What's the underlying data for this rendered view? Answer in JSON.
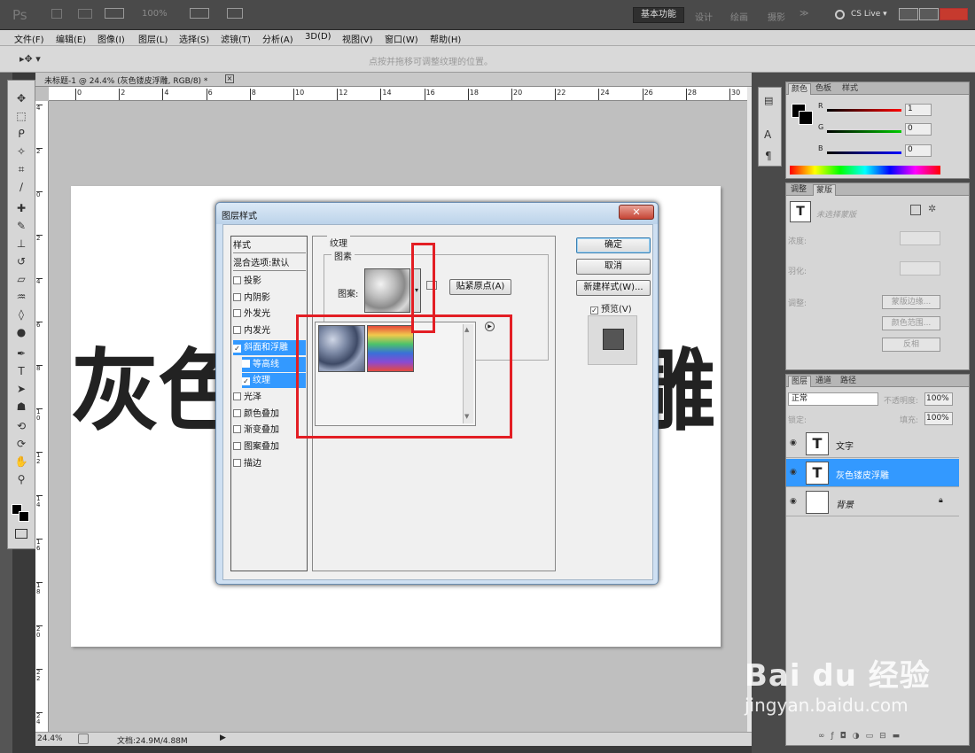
{
  "appbar": {
    "logo": "Ps",
    "zoom": "100%",
    "workspace_active": "基本功能",
    "workspaces": [
      "设计",
      "绘画",
      "摄影"
    ],
    "more": "≫",
    "cslive": "CS Live ▾"
  },
  "menu": [
    "文件(F)",
    "编辑(E)",
    "图像(I)",
    "图层(L)",
    "选择(S)",
    "滤镜(T)",
    "分析(A)",
    "3D(D)",
    "视图(V)",
    "窗口(W)",
    "帮助(H)"
  ],
  "options": {
    "hint": "点按并拖移可调整纹理的位置。"
  },
  "document": {
    "tab_title": "未标题-1 @ 24.4% (灰色镂皮浮雕, RGB/8) *",
    "ruler_h": [
      "0",
      "2",
      "4",
      "6",
      "8",
      "10",
      "12",
      "14",
      "16",
      "18",
      "20",
      "22",
      "24",
      "26",
      "28",
      "30"
    ],
    "ruler_v": [
      "4",
      "2",
      "0",
      "2",
      "4",
      "6",
      "8",
      "1 0",
      "1 2",
      "1 4",
      "1 6",
      "1 8",
      "2 0",
      "2 2",
      "2 4"
    ],
    "canvas_text_left": "灰色",
    "canvas_text_right": "雕"
  },
  "status": {
    "zoom": "24.4%",
    "doc": "文档:24.9M/4.88M"
  },
  "color_panel": {
    "tabs": [
      "颜色",
      "色板",
      "样式"
    ],
    "r_label": "R",
    "g_label": "G",
    "b_label": "B",
    "r": "1",
    "g": "0",
    "b": "0"
  },
  "adjust_panel": {
    "tabs": [
      "调整",
      "蒙版"
    ],
    "no_mask": "未选择蒙版",
    "density": "浓度:",
    "feather": "羽化:",
    "refine": "调整:",
    "btn_edge": "蒙版边缘...",
    "btn_range": "颜色范围...",
    "btn_invert": "反相"
  },
  "layers_panel": {
    "tabs": [
      "图层",
      "通道",
      "路径"
    ],
    "blend_mode": "正常",
    "opacity_label": "不透明度:",
    "opacity": "100%",
    "lock_label": "锁定:",
    "fill_label": "填充:",
    "fill": "100%",
    "layers": [
      {
        "name": "文字",
        "thumb": "T",
        "selected": false
      },
      {
        "name": "灰色镂皮浮雕",
        "thumb": "T",
        "selected": true
      },
      {
        "name": "背景",
        "thumb": "",
        "selected": false
      }
    ]
  },
  "dialog": {
    "title": "图层样式",
    "close": "✕",
    "styles_header": "样式",
    "blend_options": "混合选项:默认",
    "styles": [
      {
        "label": "投影",
        "checked": false,
        "sub": false,
        "selected": false
      },
      {
        "label": "内阴影",
        "checked": false,
        "sub": false,
        "selected": false
      },
      {
        "label": "外发光",
        "checked": false,
        "sub": false,
        "selected": false
      },
      {
        "label": "内发光",
        "checked": false,
        "sub": false,
        "selected": false
      },
      {
        "label": "斜面和浮雕",
        "checked": true,
        "sub": false,
        "selected": true
      },
      {
        "label": "等高线",
        "checked": false,
        "sub": true,
        "selected": true
      },
      {
        "label": "纹理",
        "checked": true,
        "sub": true,
        "selected": true
      },
      {
        "label": "光泽",
        "checked": false,
        "sub": false,
        "selected": false
      },
      {
        "label": "颜色叠加",
        "checked": false,
        "sub": false,
        "selected": false
      },
      {
        "label": "渐变叠加",
        "checked": false,
        "sub": false,
        "selected": false
      },
      {
        "label": "图案叠加",
        "checked": false,
        "sub": false,
        "selected": false
      },
      {
        "label": "描边",
        "checked": false,
        "sub": false,
        "selected": false
      }
    ],
    "group_texture": "纹理",
    "group_pattern": "图素",
    "pattern_label": "图案:",
    "snap_origin": "贴紧原点(A)",
    "ok": "确定",
    "cancel": "取消",
    "new_style": "新建样式(W)...",
    "preview": "预览(V)"
  },
  "watermark": {
    "brand": "Bai du 经验",
    "url": "jingyan.baidu.com"
  }
}
